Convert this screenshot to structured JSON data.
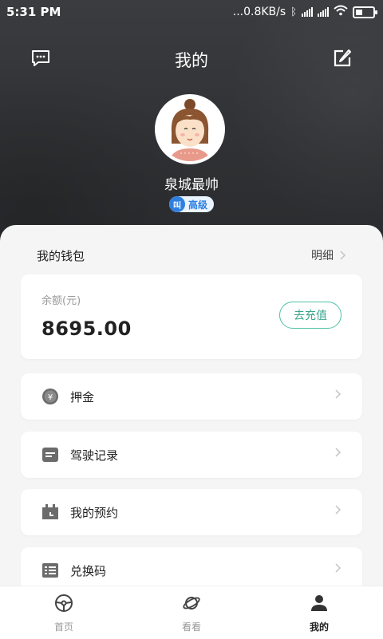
{
  "status_bar": {
    "time": "5:31 PM",
    "network_speed": "...0.8KB/s"
  },
  "header": {
    "title": "我的",
    "message_icon": "message-icon",
    "edit_icon": "edit-icon"
  },
  "profile": {
    "username": "泉城最帅",
    "level_badge": "高级",
    "level_mark": "叫"
  },
  "wallet": {
    "title": "我的钱包",
    "detail_link": "明细",
    "balance_label": "余额(元)",
    "balance_amount": "8695.00",
    "recharge_button": "去充值"
  },
  "menu": {
    "items": [
      {
        "label": "押金",
        "icon": "deposit-icon"
      },
      {
        "label": "驾驶记录",
        "icon": "driving-record-icon"
      },
      {
        "label": "我的预约",
        "icon": "reservation-icon"
      },
      {
        "label": "兑换码",
        "icon": "redeem-code-icon"
      }
    ]
  },
  "tabbar": {
    "tabs": [
      {
        "label": "首页",
        "icon": "steering-wheel-icon",
        "active": false
      },
      {
        "label": "看看",
        "icon": "planet-icon",
        "active": false
      },
      {
        "label": "我的",
        "icon": "user-icon",
        "active": true
      }
    ]
  },
  "colors": {
    "accent_green": "#3aa68c",
    "badge_blue": "#2f7fe0",
    "header_bg": "#333438"
  }
}
